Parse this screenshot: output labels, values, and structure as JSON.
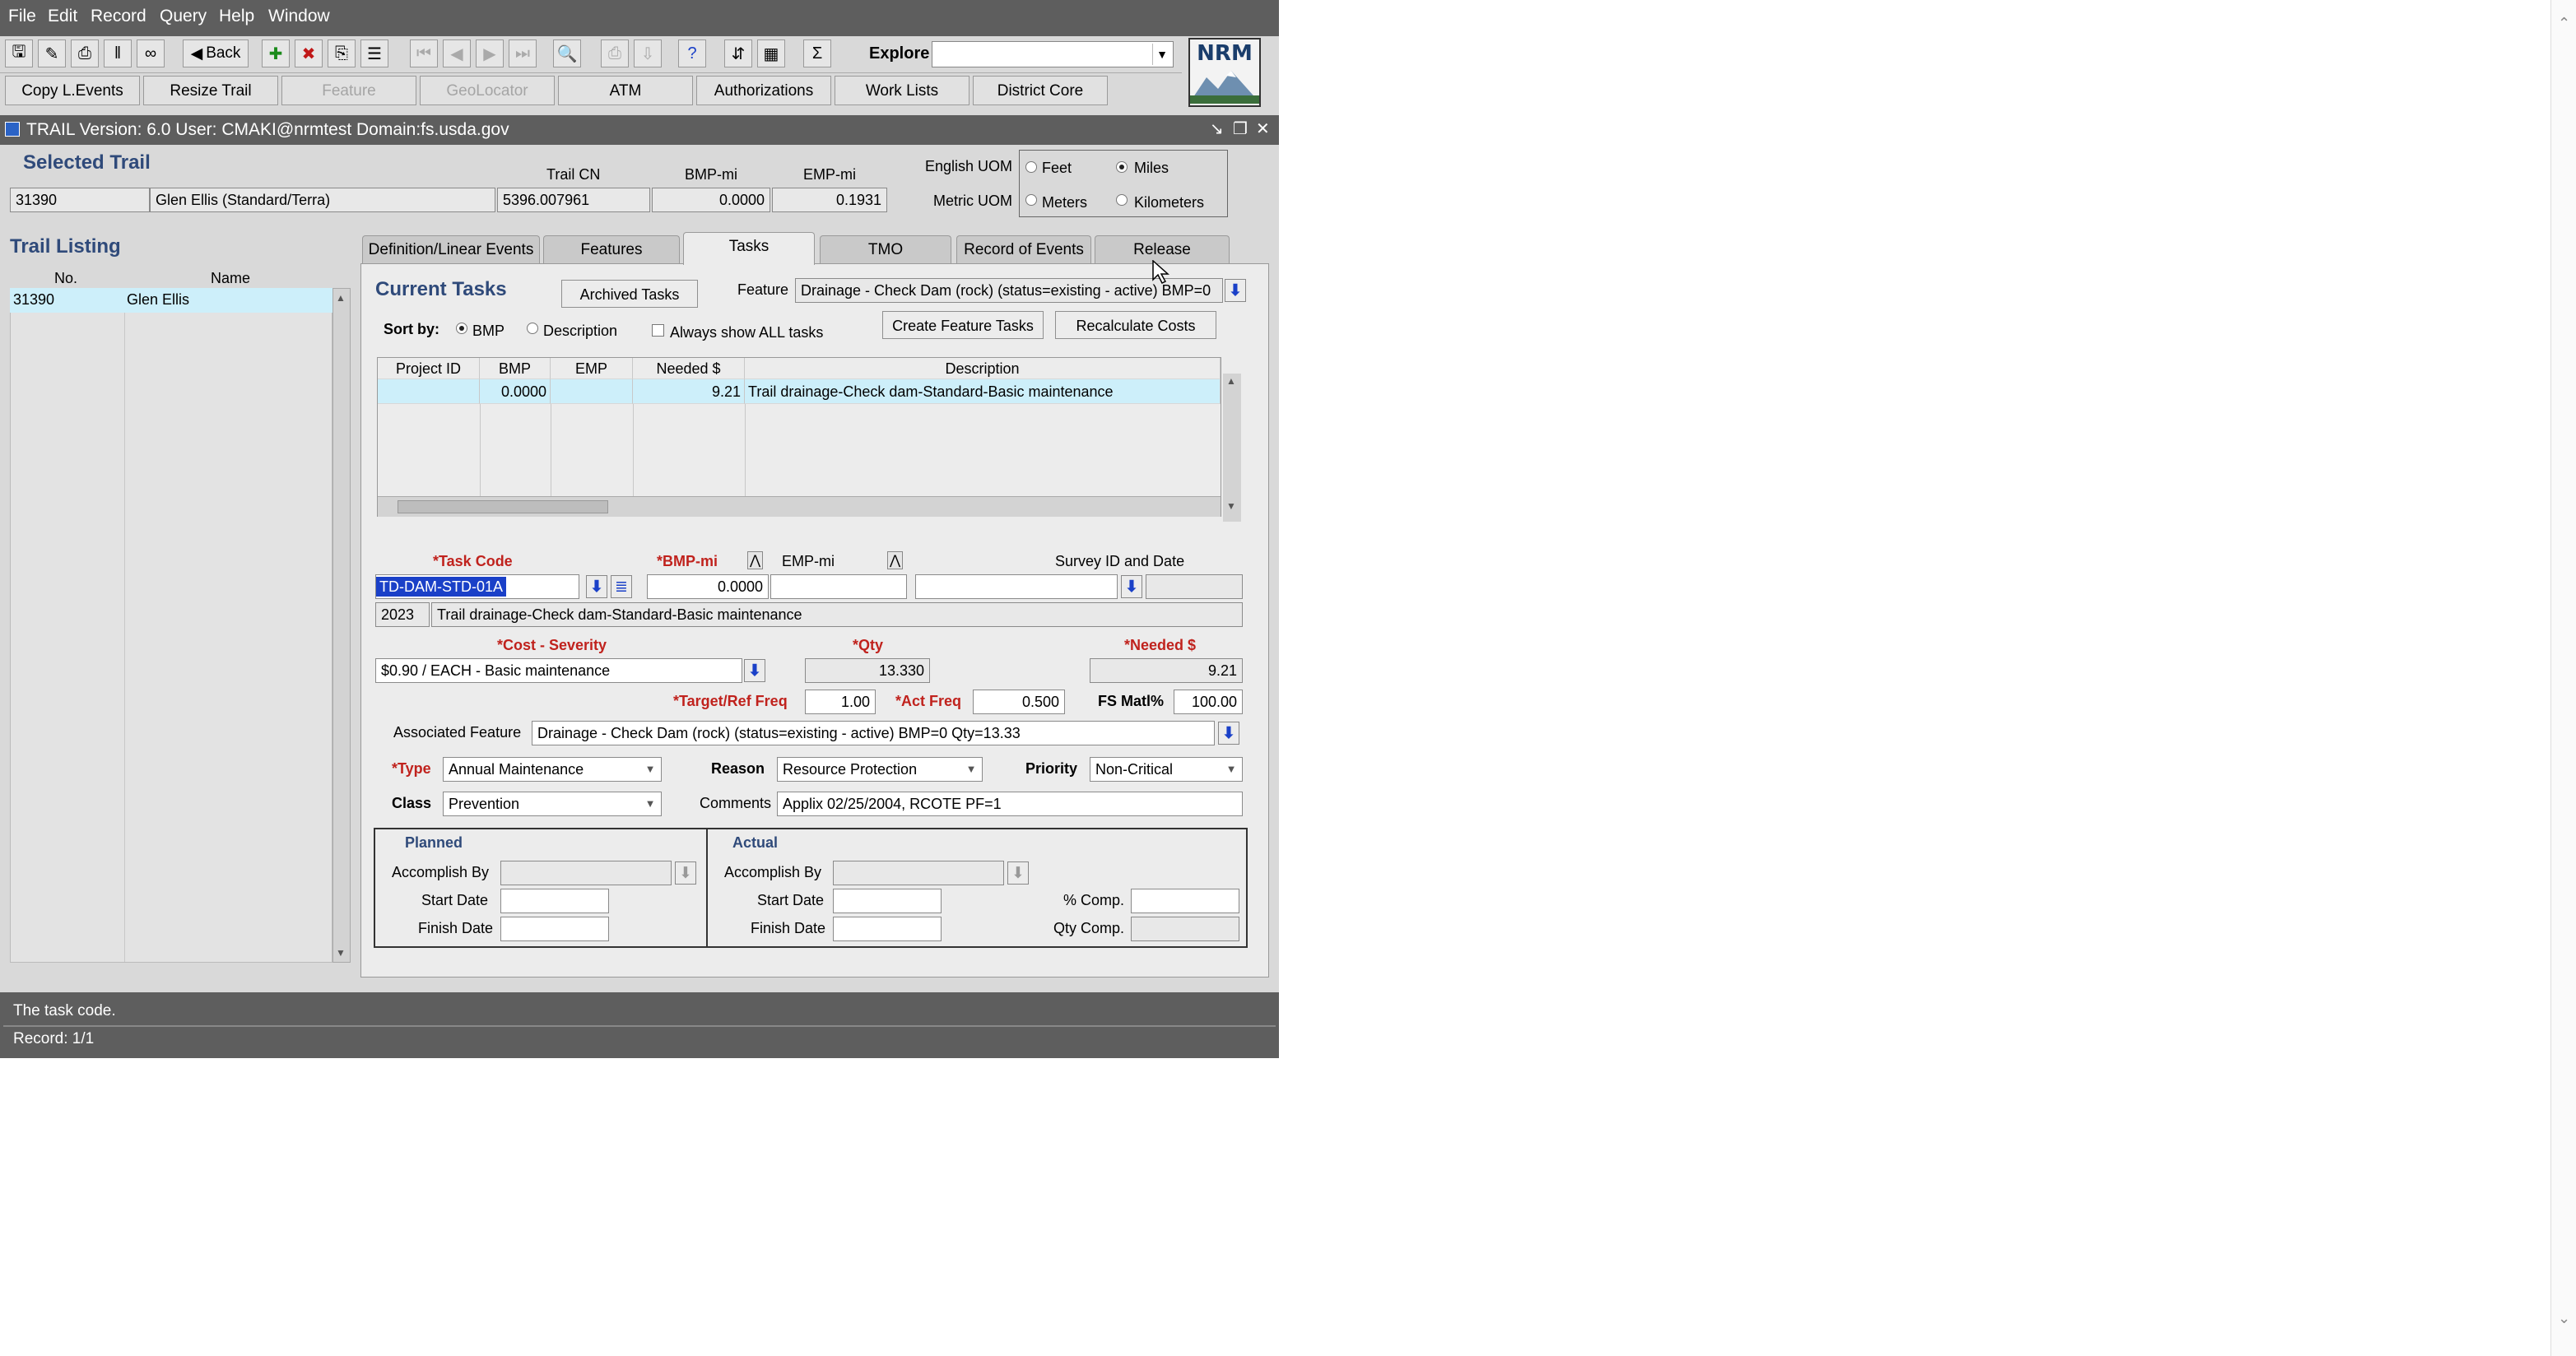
{
  "menu": {
    "items": [
      "File",
      "Edit",
      "Record",
      "Query",
      "Help",
      "Window"
    ]
  },
  "toolbar": {
    "back_label": "Back",
    "explore_label": "Explore",
    "explore_value": ""
  },
  "logo": {
    "text": "NRM"
  },
  "button_row": {
    "buttons": [
      "Copy L.Events",
      "Resize Trail",
      "Feature",
      "GeoLocator",
      "ATM",
      "Authorizations",
      "Work Lists",
      "District Core"
    ]
  },
  "window": {
    "title": "TRAIL  Version: 6.0  User: CMAKI@nrmtest  Domain:fs.usda.gov"
  },
  "selected_trail": {
    "heading": "Selected Trail",
    "col_trail_cn": "Trail CN",
    "col_bmp": "BMP-mi",
    "col_emp": "EMP-mi",
    "number": "31390",
    "name": "Glen Ellis (Standard/Terra)",
    "trail_cn": "5396.007961",
    "bmp": "0.0000",
    "emp": "0.1931"
  },
  "uom": {
    "english_label": "English UOM",
    "metric_label": "Metric UOM",
    "feet": "Feet",
    "miles": "Miles",
    "meters": "Meters",
    "kilometers": "Kilometers",
    "selected": "Miles"
  },
  "trail_listing": {
    "heading": "Trail Listing",
    "col_no": "No.",
    "col_name": "Name",
    "rows": [
      {
        "no": "31390",
        "name": "Glen Ellis"
      }
    ]
  },
  "tabs": [
    "Definition/Linear Events",
    "Features",
    "Tasks",
    "TMO",
    "Record of Events",
    "Release"
  ],
  "active_tab": "Tasks",
  "tasks": {
    "heading": "Current Tasks",
    "archived_button": "Archived Tasks",
    "feature_label": "Feature",
    "feature_value": "Drainage - Check Dam (rock) (status=existing - active)  BMP=0",
    "sort_label": "Sort by:",
    "sort_bmp": "BMP",
    "sort_description": "Description",
    "always_show_all": "Always show ALL tasks",
    "create_button": "Create Feature Tasks",
    "recalc_button": "Recalculate Costs",
    "grid_headers": [
      "Project ID",
      "BMP",
      "EMP",
      "Needed $",
      "Description"
    ],
    "grid_rows": [
      {
        "project_id": "",
        "bmp": "0.0000",
        "emp": "",
        "needed": "9.21",
        "description": "Trail drainage-Check dam-Standard-Basic maintenance"
      }
    ]
  },
  "detail": {
    "task_code_label": "*Task Code",
    "task_code": "TD-DAM-STD-01A",
    "bmp_label": "*BMP-mi",
    "bmp": "0.0000",
    "emp_label": "EMP-mi",
    "emp": "",
    "survey_label": "Survey ID and Date",
    "year": "2023",
    "task_description": "Trail drainage-Check dam-Standard-Basic maintenance",
    "cost_label": "*Cost - Severity",
    "cost_value": "$0.90 / EACH - Basic maintenance",
    "qty_label": "*Qty",
    "qty": "13.330",
    "needed_label": "*Needed $",
    "needed": "9.21",
    "target_freq_label": "*Target/Ref Freq",
    "target_freq": "1.00",
    "act_freq_label": "*Act Freq",
    "act_freq": "0.500",
    "fs_matl_label": "FS Matl%",
    "fs_matl": "100.00",
    "assoc_label": "Associated Feature",
    "assoc_value": "Drainage - Check Dam (rock) (status=existing - active)  BMP=0  Qty=13.33",
    "type_label": "*Type",
    "type_value": "Annual Maintenance",
    "reason_label": "Reason",
    "reason_value": "Resource Protection",
    "priority_label": "Priority",
    "priority_value": "Non-Critical",
    "class_label": "Class",
    "class_value": "Prevention",
    "comments_label": "Comments",
    "comments_value": "Applix 02/25/2004, RCOTE PF=1"
  },
  "planned": {
    "heading": "Planned",
    "accomplish_by": "Accomplish By",
    "start_date": "Start Date",
    "finish_date": "Finish Date"
  },
  "actual": {
    "heading": "Actual",
    "accomplish_by": "Accomplish By",
    "start_date": "Start Date",
    "finish_date": "Finish Date",
    "pct_comp": "% Comp.",
    "qty_comp": "Qty Comp."
  },
  "status": {
    "message": "The task code.",
    "record": "Record: 1/1"
  },
  "colors": {
    "title_bar": "#5e5e5e",
    "section_title": "#2f4a7a",
    "required_label": "#c0221d",
    "selection": "#cdeffa",
    "highlight": "#1a40c8"
  }
}
